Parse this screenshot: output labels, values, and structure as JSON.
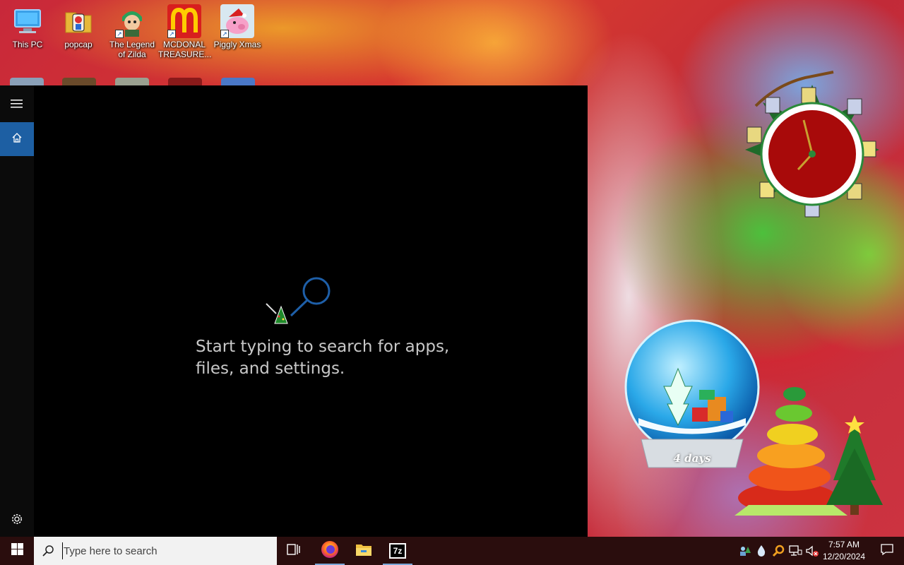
{
  "desktop": {
    "icons": [
      {
        "label": "This PC",
        "icon": "this-pc-icon"
      },
      {
        "label": "popcap",
        "icon": "folder-icon"
      },
      {
        "label": "The Legend of Zilda",
        "icon": "game-character-icon"
      },
      {
        "label": "MCDONAL TREASURE...",
        "icon": "mcdonalds-icon"
      },
      {
        "label": "Piggly Xmas",
        "icon": "pig-icon"
      }
    ]
  },
  "start_menu": {
    "search_hint": "Start typing to search for apps, files, and settings.",
    "rail": {
      "menu_icon": "hamburger-icon",
      "home_icon": "home-icon",
      "settings_icon": "gear-icon"
    }
  },
  "gadgets": {
    "countdown_label": "4 days"
  },
  "taskbar": {
    "search_placeholder": "Type here to search",
    "pinned": [
      "task-view-icon",
      "firefox-icon",
      "file-explorer-icon",
      "7zip-icon"
    ],
    "sevenzip_label": "7z",
    "clock_time": "7:57 AM",
    "clock_date": "12/20/2024"
  },
  "colors": {
    "accent": "#1d5fa3",
    "taskbar": "#2a0d0d",
    "panel": "#000000"
  }
}
